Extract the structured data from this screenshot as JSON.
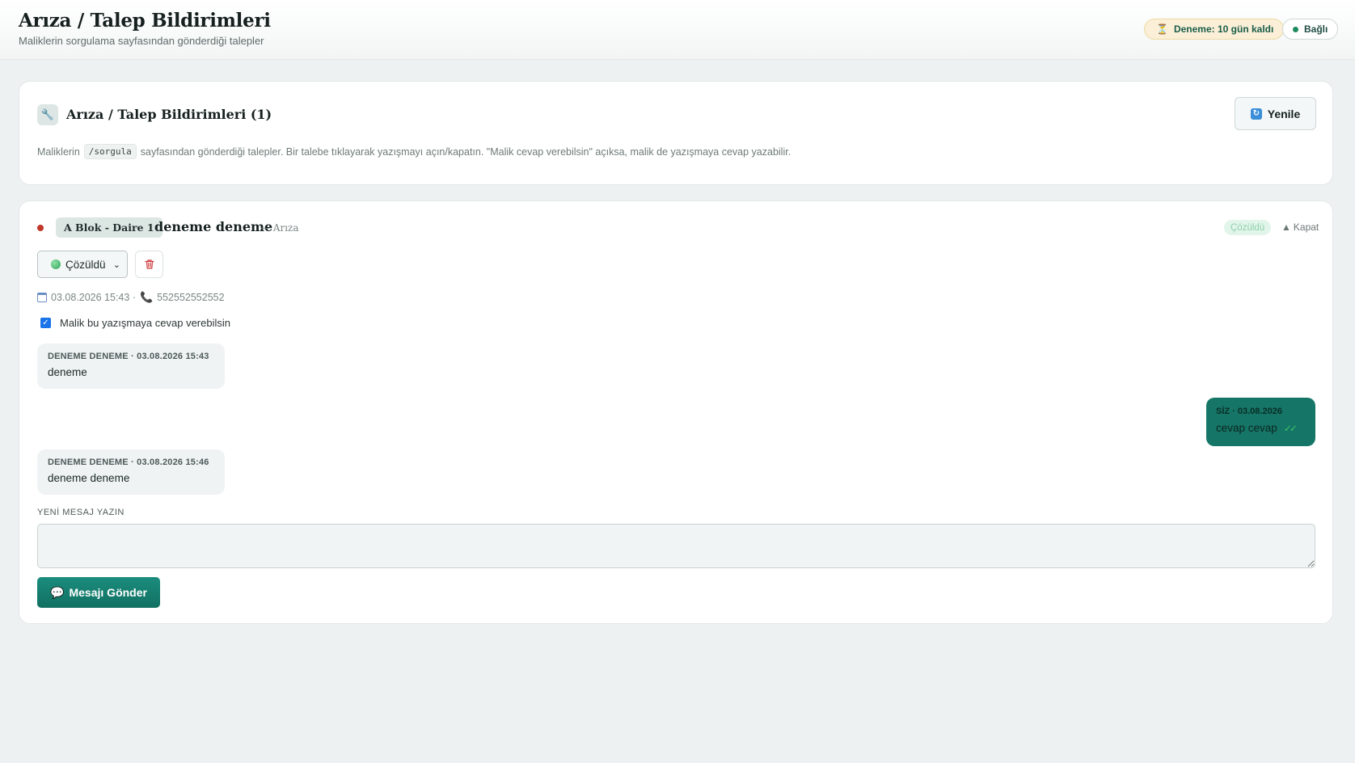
{
  "header": {
    "title": "Arıza / Talep Bildirimleri",
    "subtitle": "Maliklerin sorgulama sayfasından gönderdiği talepler",
    "trial_badge": "Deneme: 10 gün kaldı",
    "connection_badge": "Bağlı"
  },
  "panel": {
    "title": "Arıza / Talep Bildirimleri (1)",
    "refresh_label": "Yenile",
    "desc_before": "Maliklerin",
    "desc_code": "/sorgula",
    "desc_after": "sayfasından gönderdiği talepler. Bir talebe tıklayarak yazışmayı açın/kapatın. \"Malik cevap verebilsin\" açıksa, malik de yazışmaya cevap yazabilir."
  },
  "request": {
    "unit": "A Blok - Daire 1",
    "title": "deneme deneme",
    "category": "— Arıza",
    "status_pill": "Çözüldü",
    "collapse_label": "Kapat",
    "status_select": "Çözüldü",
    "date": "03.08.2026 15:43 ·",
    "phone": "552552552552",
    "allow_reply_checked": true,
    "allow_reply_label": "Malik bu yazışmaya cevap verebilsin"
  },
  "messages": [
    {
      "from": "owner",
      "meta": "DENEME DENEME · 03.08.2026 15:43",
      "text": "deneme"
    },
    {
      "from": "me",
      "meta": "SİZ · 03.08.2026",
      "text": "cevap cevap"
    },
    {
      "from": "owner",
      "meta": "DENEME DENEME · 03.08.2026 15:46",
      "text": "deneme deneme"
    }
  ],
  "composer": {
    "label": "YENİ MESAJ YAZIN",
    "value": "",
    "send_label": "Mesajı Gönder"
  },
  "colors": {
    "accent": "#157566",
    "status_dot": "#c0392b",
    "page_bg": "#eef1f1"
  },
  "icons": [
    "hourglass-icon",
    "connection-dot-icon",
    "wrench-icon",
    "refresh-icon",
    "green-circle-icon",
    "trash-icon",
    "calendar-icon",
    "phone-icon",
    "chat-bubble-icon",
    "double-check-icon",
    "triangle-up-icon"
  ]
}
